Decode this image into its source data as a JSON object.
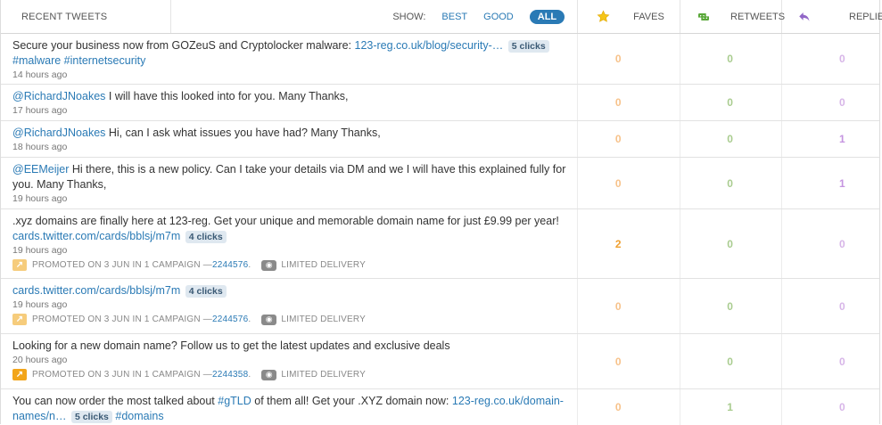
{
  "header": {
    "title": "RECENT TWEETS",
    "show_label": "SHOW:",
    "filters": [
      {
        "label": "BEST",
        "active": false
      },
      {
        "label": "GOOD",
        "active": false
      },
      {
        "label": "ALL",
        "active": true
      }
    ],
    "faves_label": "FAVES",
    "retweets_label": "RETWEETS",
    "replies_label": "REPLIES"
  },
  "icons": {
    "faves": "star-icon",
    "retweets": "retweet-icon",
    "replies": "reply-icon"
  },
  "rows": [
    {
      "text": "Secure your business now from GOZeuS and Cryptolocker malware: ",
      "link": "123-reg.co.uk/blog/security-…",
      "clicks": "5 clicks",
      "tags": "#malware #internetsecurity",
      "time": "14 hours ago",
      "faves": "0",
      "retweets": "0",
      "replies": "0"
    },
    {
      "mention": "@RichardJNoakes",
      "text": " I will have this looked into for you. Many Thanks,",
      "time": "17 hours ago",
      "faves": "0",
      "retweets": "0",
      "replies": "0"
    },
    {
      "mention": "@RichardJNoakes",
      "text": " Hi, can I ask what issues you have had? Many Thanks,",
      "time": "18 hours ago",
      "faves": "0",
      "retweets": "0",
      "replies": "1"
    },
    {
      "mention": "@EEMeijer",
      "text": " Hi there, this is a new policy. Can I take your details via DM and we I will have this explained fully for you. Many Thanks,",
      "time": "19 hours ago",
      "faves": "0",
      "retweets": "0",
      "replies": "1"
    },
    {
      "text": ".xyz domains are finally here at 123-reg. Get your unique and memorable domain name for just £9.99 per year! ",
      "link": "cards.twitter.com/cards/bblsj/m7m",
      "clicks": "4 clicks",
      "time": "19 hours ago",
      "promo": "PROMOTED ON 3 JUN IN 1 CAMPAIGN — ",
      "campaign": "2244576",
      "delivery": "LIMITED DELIVERY",
      "faves": "2",
      "retweets": "0",
      "replies": "0"
    },
    {
      "link": "cards.twitter.com/cards/bblsj/m7m",
      "clicks": "4 clicks",
      "time": "19 hours ago",
      "promo": "PROMOTED ON 3 JUN IN 1 CAMPAIGN — ",
      "campaign": "2244576",
      "delivery": "LIMITED DELIVERY",
      "faves": "0",
      "retweets": "0",
      "replies": "0"
    },
    {
      "text": "Looking for a new domain name? Follow us to get the latest updates and exclusive deals",
      "time": "20 hours ago",
      "promo": "PROMOTED ON 3 JUN IN 1 CAMPAIGN — ",
      "campaign": "2244358",
      "delivery": "LIMITED DELIVERY",
      "faves": "0",
      "retweets": "0",
      "replies": "0"
    },
    {
      "text": "You can now order the most talked about ",
      "hashtag": "#gTLD",
      "text2": " of them all! Get your .XYZ domain now: ",
      "link": "123-reg.co.uk/domain-names/n…",
      "clicks": "5 clicks",
      "tags": "#domains",
      "faves": "0",
      "retweets": "1",
      "replies": "0"
    }
  ]
}
